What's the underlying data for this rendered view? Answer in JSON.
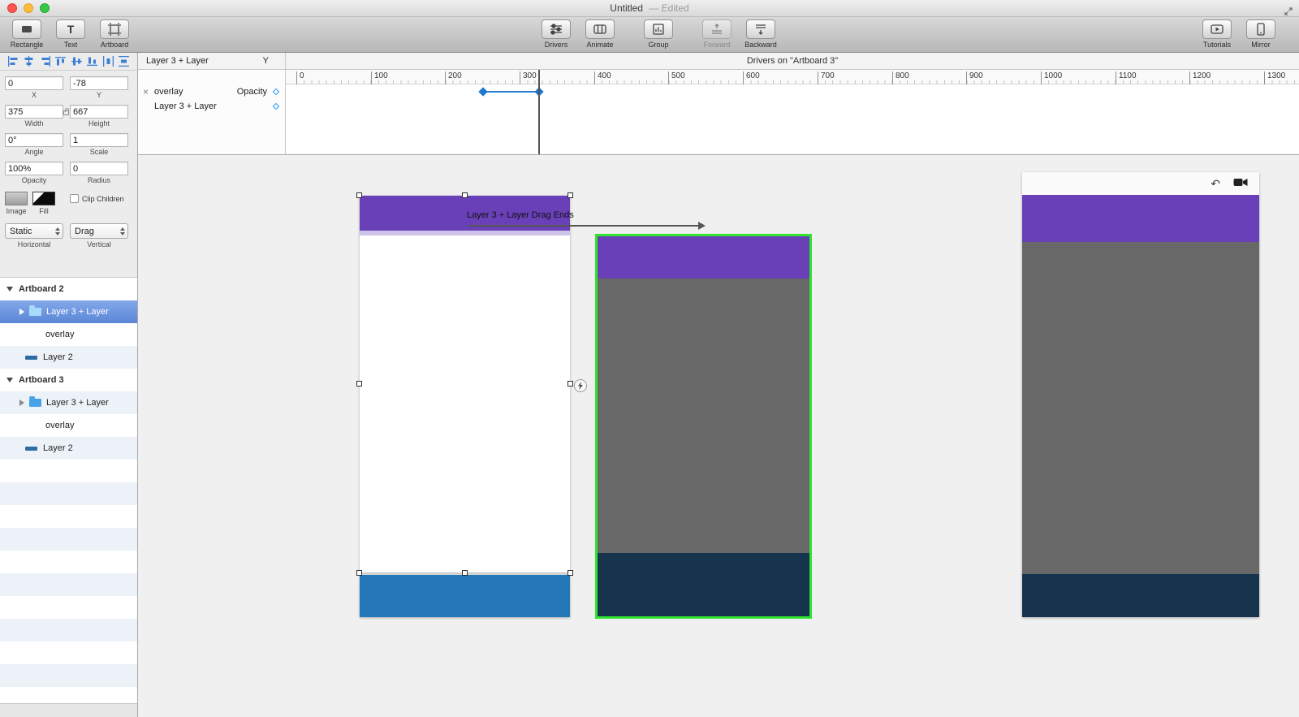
{
  "titlebar": {
    "title": "Untitled",
    "edited": "— Edited"
  },
  "toolbar": {
    "rectangle": "Rectangle",
    "text": "Text",
    "artboard": "Artboard",
    "drivers": "Drivers",
    "animate": "Animate",
    "group": "Group",
    "forward": "Forward",
    "backward": "Backward",
    "tutorials": "Tutorials",
    "mirror": "Mirror"
  },
  "inspector": {
    "x_value": "0",
    "x_label": "X",
    "y_value": "-78",
    "y_label": "Y",
    "width_value": "375",
    "width_label": "Width",
    "height_value": "667",
    "height_label": "Height",
    "angle_value": "0°",
    "angle_label": "Angle",
    "scale_value": "1",
    "scale_label": "Scale",
    "opacity_value": "100%",
    "opacity_label": "Opacity",
    "radius_value": "0",
    "radius_label": "Radius",
    "image_label": "Image",
    "fill_label": "Fill",
    "clip_children": "Clip Children",
    "horizontal_value": "Static",
    "horizontal_label": "Horizontal",
    "vertical_value": "Drag",
    "vertical_label": "Vertical"
  },
  "layers": [
    {
      "label": "Artboard 2",
      "type": "artboard"
    },
    {
      "label": "Layer 3 + Layer",
      "type": "group",
      "selected": true
    },
    {
      "label": "overlay",
      "type": "plain"
    },
    {
      "label": "Layer 2",
      "type": "layer"
    },
    {
      "label": "Artboard 3",
      "type": "artboard"
    },
    {
      "label": "Layer 3 + Layer",
      "type": "group"
    },
    {
      "label": "overlay",
      "type": "plain"
    },
    {
      "label": "Layer 2",
      "type": "layer"
    }
  ],
  "timeline": {
    "title": "Drivers on \"Artboard 3\"",
    "header_name": "Layer 3 + Layer",
    "header_property": "Y",
    "row1_name": "overlay",
    "row1_property": "Opacity",
    "row2_name": "Layer 3 + Layer",
    "ticks": [
      "0",
      "100",
      "200",
      "300",
      "400",
      "500",
      "600",
      "700",
      "800",
      "900",
      "1000",
      "1100",
      "1200",
      "1300"
    ]
  },
  "canvas": {
    "drag_end_label": "Layer 3 + Layer Drag Ends",
    "colors": {
      "purple": "#6a40b8",
      "body_gray": "#686868",
      "navy": "#16344e",
      "footer_blue": "#2478b8",
      "selection_green": "#2fe52f",
      "keyframe_blue": "#1e78d0",
      "selected_row_blue": "#5b86d7"
    }
  }
}
